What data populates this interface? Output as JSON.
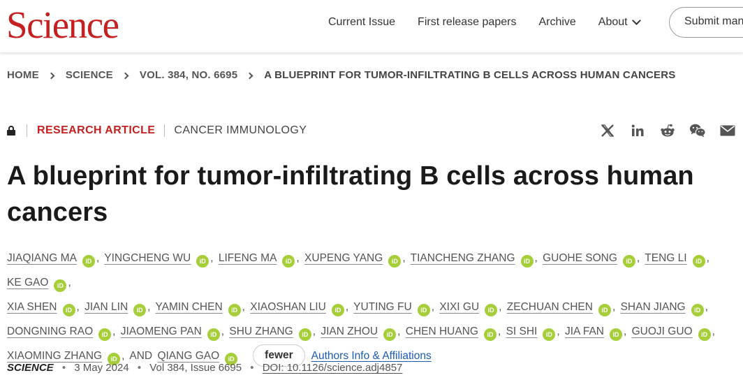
{
  "header": {
    "logo": "Science",
    "nav": [
      "Current Issue",
      "First release papers",
      "Archive",
      "About"
    ],
    "submit_label": "Submit manuscript"
  },
  "breadcrumb": [
    "HOME",
    "SCIENCE",
    "VOL. 384, NO. 6695",
    "A BLUEPRINT FOR TUMOR-INFILTRATING B CELLS ACROSS HUMAN CANCERS"
  ],
  "meta": {
    "article_type": "RESEARCH ARTICLE",
    "category": "CANCER IMMUNOLOGY",
    "share_icons": [
      "x-icon",
      "linkedin-icon",
      "reddit-icon",
      "wechat-icon",
      "email-icon"
    ]
  },
  "title": "A blueprint for tumor-infiltrating B cells across human cancers",
  "authors": [
    "JIAQIANG MA",
    "YINGCHENG WU",
    "LIFENG MA",
    "XUPENG YANG",
    "TIANCHENG ZHANG",
    "GUOHE SONG",
    "TENG LI",
    "KE GAO",
    "XIA SHEN",
    "JIAN LIN",
    "YAMIN CHEN",
    "XIAOSHAN LIU",
    "YUTING FU",
    "XIXI GU",
    "ZECHUAN CHEN",
    "SHAN JIANG",
    "DONGNING RAO",
    "JIAOMENG PAN",
    "SHU ZHANG",
    "JIAN ZHOU",
    "CHEN HUANG",
    "SI SHI",
    "JIA FAN",
    "GUOJI GUO",
    "XIAOMING ZHANG",
    "QIANG GAO"
  ],
  "author_controls": {
    "and_label": "AND",
    "orcid_label": "iD",
    "fewer_label": "fewer",
    "affiliations_label": "Authors Info & Affiliations"
  },
  "citation": {
    "journal": "SCIENCE",
    "date": "3 May 2024",
    "volume": "Vol 384, Issue 6695",
    "doi": "DOI: 10.1126/science.adj4857"
  },
  "colors": {
    "brand_red": "#c5201f",
    "orcid_green": "#a6ce39",
    "link_blue": "#1a5bb8"
  }
}
